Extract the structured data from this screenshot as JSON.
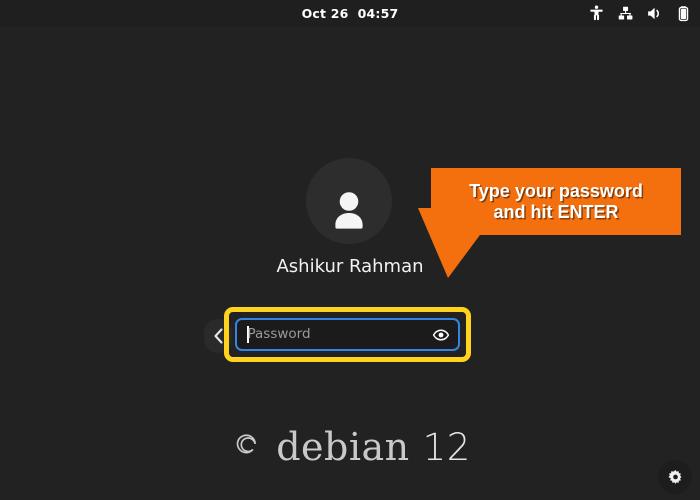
{
  "screen": {
    "background_color": "#222222",
    "type": "gnome-display-manager-login-screen"
  },
  "topbar": {
    "background_color": "#1f1f1f",
    "clock": "Oct 26  04:57",
    "tray": [
      {
        "name": "accessibility-icon",
        "label": "Accessibility"
      },
      {
        "name": "wired-network-icon",
        "label": "Wired Network"
      },
      {
        "name": "volume-icon",
        "label": "Volume"
      },
      {
        "name": "battery-icon",
        "label": "Battery"
      }
    ]
  },
  "login": {
    "avatar": {
      "icon": "user-avatar-icon",
      "background_color": "#2d2d2d"
    },
    "username": "Ashikur Rahman",
    "back_button": {
      "icon": "chevron-left-icon",
      "label": "Back"
    },
    "password": {
      "placeholder": "Password",
      "value": "",
      "focused": true,
      "focus_border_color": "#3584e4",
      "reveal_icon": "eye-icon"
    },
    "highlight": {
      "color": "#ffd21e",
      "target": "password-input"
    }
  },
  "callout": {
    "background_color": "#f4700f",
    "text_color": "#ffffff",
    "line1": "Type your password",
    "line2": "and hit ENTER"
  },
  "brand": {
    "logo_icon": "debian-swirl-icon",
    "name": "debian",
    "version": "12"
  },
  "settings": {
    "icon": "gear-icon",
    "label": "Settings"
  }
}
